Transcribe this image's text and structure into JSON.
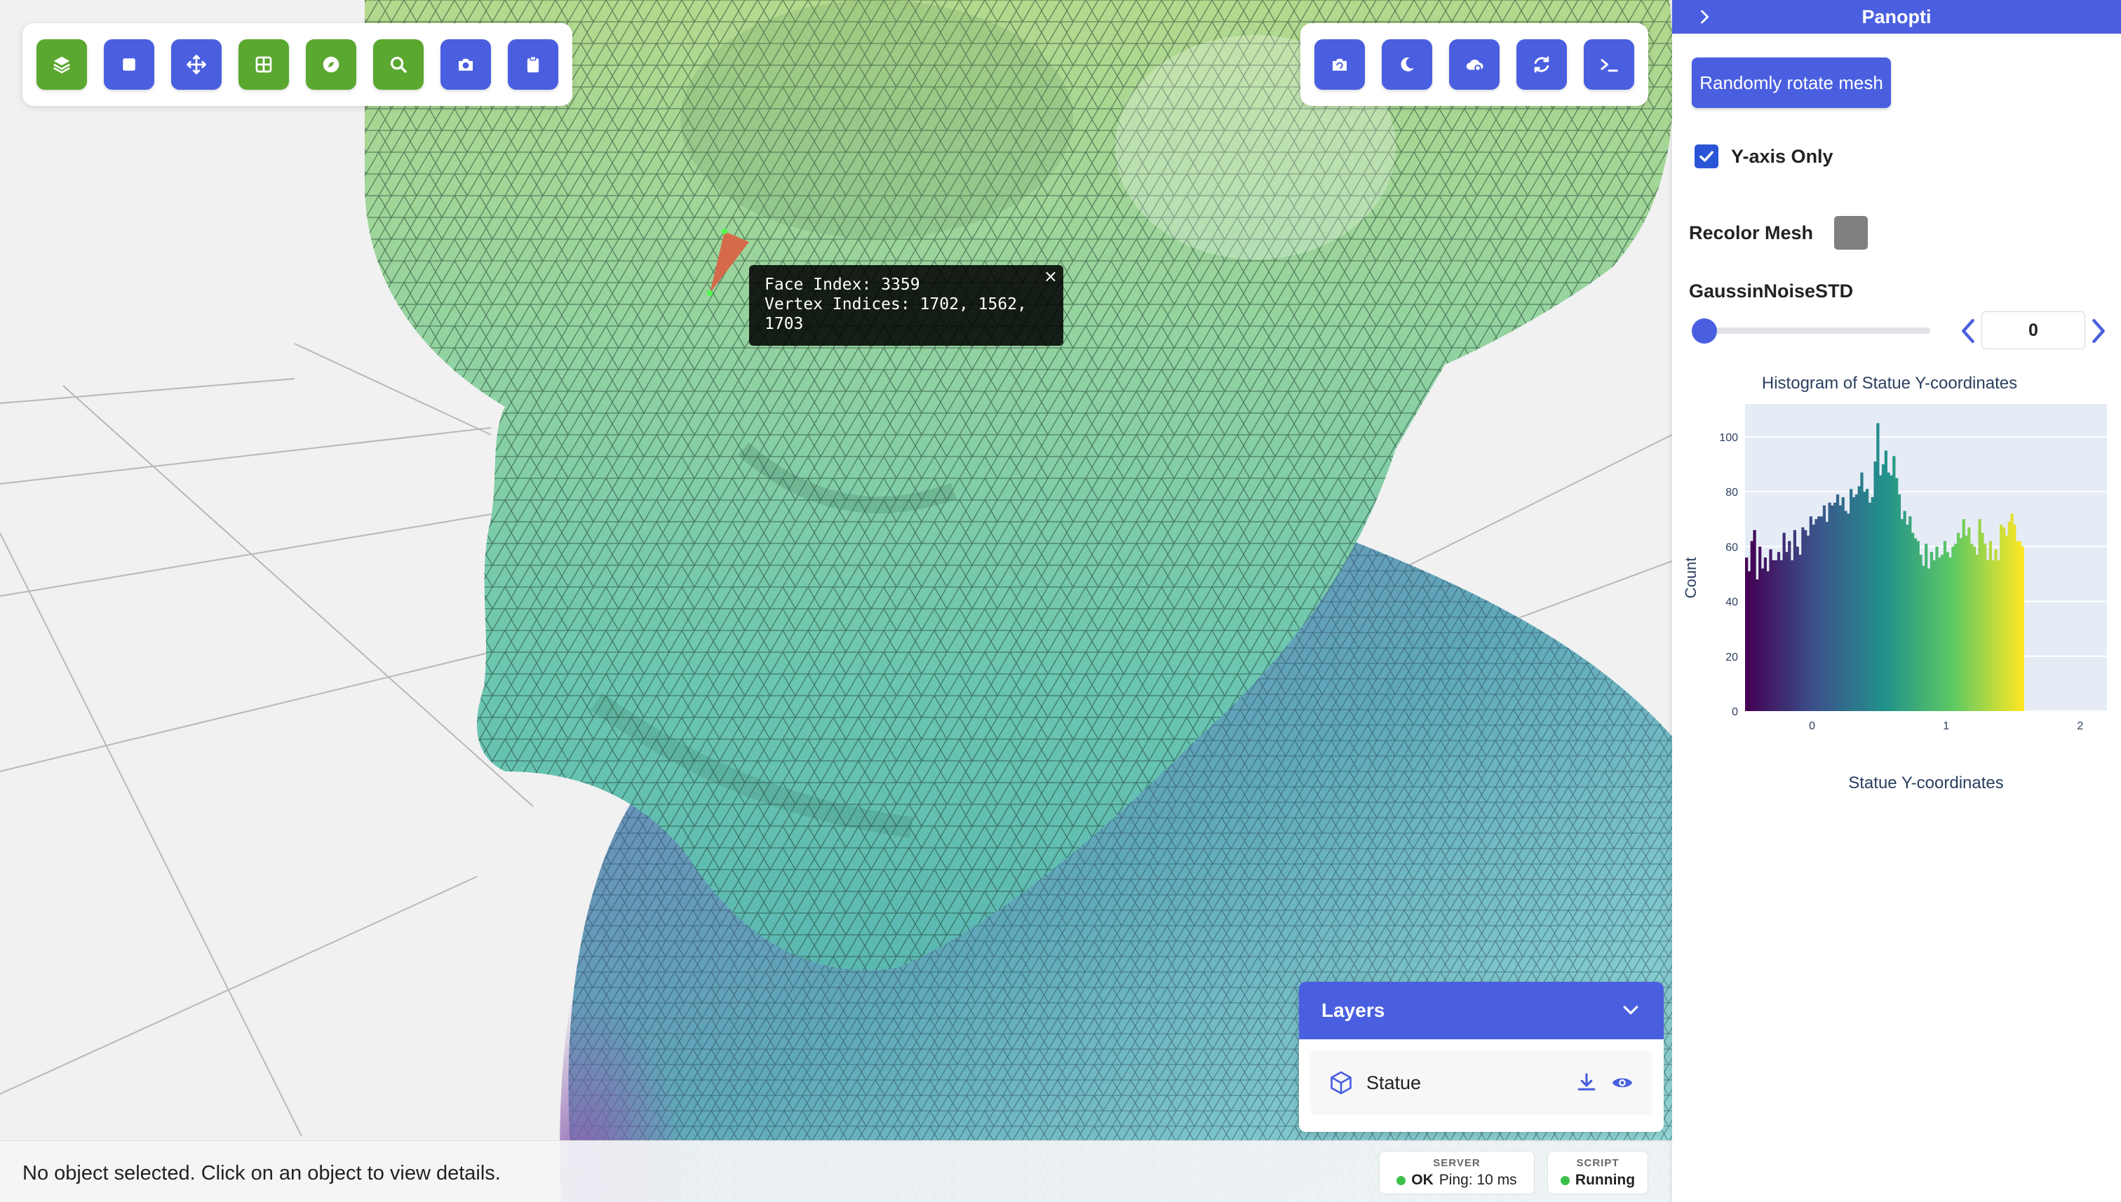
{
  "viewport": {
    "left_toolbar": [
      {
        "icon": "layers-icon",
        "color": "green"
      },
      {
        "icon": "square-icon",
        "color": "blue"
      },
      {
        "icon": "move-icon",
        "color": "blue"
      },
      {
        "icon": "grid-icon",
        "color": "green"
      },
      {
        "icon": "compass-icon",
        "color": "green"
      },
      {
        "icon": "search-icon",
        "color": "green"
      },
      {
        "icon": "camera-icon",
        "color": "blue"
      },
      {
        "icon": "clipboard-icon",
        "color": "blue"
      }
    ],
    "right_toolbar": [
      {
        "icon": "camera-rotate-icon",
        "color": "blue"
      },
      {
        "icon": "moon-icon",
        "color": "blue"
      },
      {
        "icon": "cloud-search-icon",
        "color": "blue"
      },
      {
        "icon": "refresh-icon",
        "color": "blue"
      },
      {
        "icon": "terminal-icon",
        "color": "blue"
      }
    ],
    "tooltip": {
      "line1": "Face Index: 3359",
      "line2": "Vertex Indices: 1702, 1562,",
      "line3": "1703",
      "close": "×"
    }
  },
  "layers": {
    "title": "Layers",
    "items": [
      {
        "name": "Statue"
      }
    ]
  },
  "status": {
    "message": "No object selected. Click on an object to view details.",
    "server_caption": "SERVER",
    "server_state": "OK",
    "server_ping": "Ping: 10 ms",
    "script_caption": "SCRIPT",
    "script_state": "Running"
  },
  "panel": {
    "title": "Panopti",
    "rotate_button": "Randomly rotate mesh",
    "yaxis_label": "Y-axis Only",
    "yaxis_checked": true,
    "recolor_label": "Recolor Mesh",
    "recolor_color": "#808080",
    "noise_label": "GaussinNoiseSTD",
    "noise_value": "0"
  },
  "colors": {
    "accent": "#4a5fe0",
    "green": "#5aa82f"
  },
  "chart_data": {
    "type": "bar",
    "title": "Histogram of Statue Y-coordinates",
    "xlabel": "Statue Y-coordinates",
    "ylabel": "Count",
    "xlim": [
      -0.5,
      2.2
    ],
    "ylim": [
      0,
      112
    ],
    "x_ticks": [
      "0",
      "1",
      "2"
    ],
    "y_ticks": [
      "0",
      "20",
      "40",
      "60",
      "80",
      "100"
    ],
    "bin_width": 0.02,
    "colorscale": "viridis",
    "values": [
      56,
      51,
      62,
      66,
      48,
      60,
      52,
      56,
      51,
      59,
      55,
      55,
      58,
      55,
      65,
      58,
      62,
      55,
      66,
      60,
      57,
      67,
      66,
      64,
      71,
      68,
      70,
      71,
      71,
      75,
      69,
      76,
      75,
      76,
      79,
      75,
      78,
      73,
      72,
      81,
      78,
      79,
      82,
      87,
      80,
      81,
      76,
      78,
      91,
      105,
      86,
      90,
      95,
      87,
      86,
      93,
      85,
      79,
      70,
      73,
      68,
      71,
      65,
      63,
      62,
      57,
      53,
      61,
      52,
      58,
      55,
      60,
      56,
      57,
      62,
      58,
      56,
      60,
      61,
      65,
      63,
      70,
      64,
      67,
      61,
      60,
      57,
      70,
      65,
      61,
      55,
      62,
      55,
      59,
      55,
      68,
      67,
      64,
      69,
      72,
      68,
      62,
      62,
      60
    ]
  }
}
